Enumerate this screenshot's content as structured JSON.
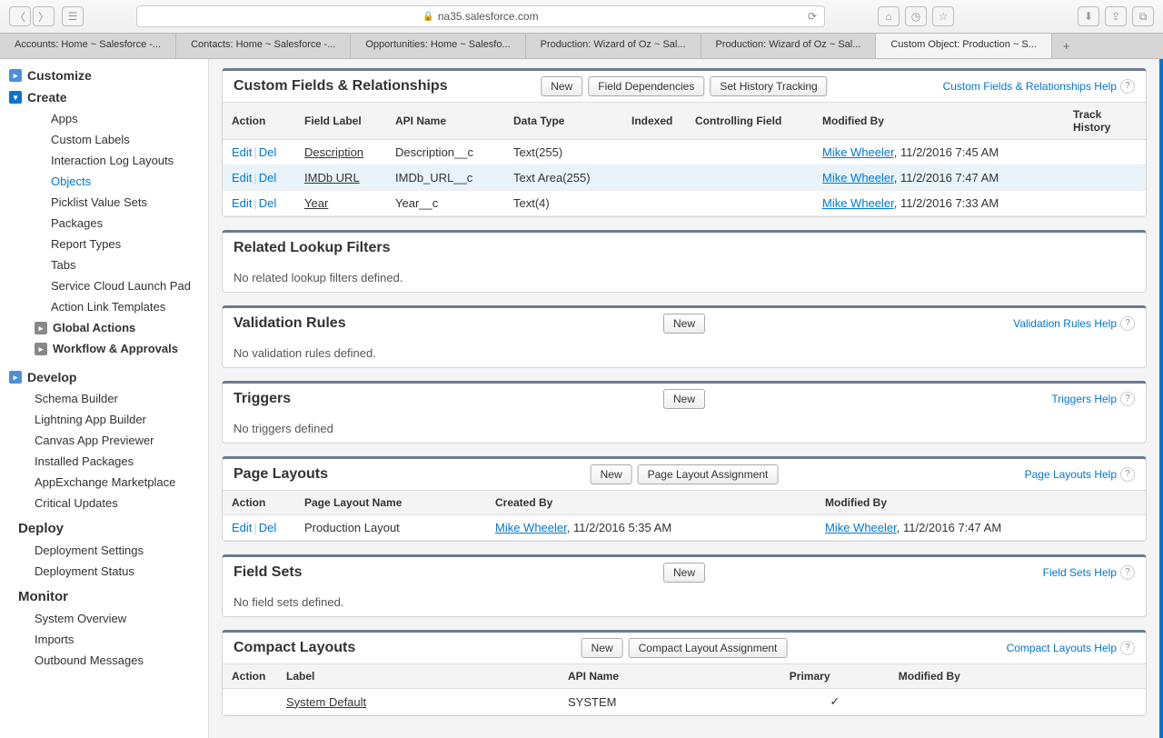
{
  "browser": {
    "url": "na35.salesforce.com",
    "tabs": [
      {
        "label": "Accounts: Home ~ Salesforce -..."
      },
      {
        "label": "Contacts: Home ~ Salesforce -..."
      },
      {
        "label": "Opportunities: Home ~ Salesfo..."
      },
      {
        "label": "Production: Wizard of Oz ~ Sal..."
      },
      {
        "label": "Production: Wizard of Oz ~ Sal..."
      },
      {
        "label": "Custom Object: Production ~ S..."
      }
    ],
    "activeTab": 5
  },
  "sidebar": {
    "customize": "Customize",
    "create": "Create",
    "createItems": [
      "Apps",
      "Custom Labels",
      "Interaction Log Layouts",
      "Objects",
      "Picklist Value Sets",
      "Packages",
      "Report Types",
      "Tabs",
      "Service Cloud Launch Pad",
      "Action Link Templates"
    ],
    "globalActions": "Global Actions",
    "workflow": "Workflow & Approvals",
    "develop": "Develop",
    "developItems": [
      "Schema Builder",
      "Lightning App Builder",
      "Canvas App Previewer",
      "Installed Packages",
      "AppExchange Marketplace",
      "Critical Updates"
    ],
    "deploy": "Deploy",
    "deployItems": [
      "Deployment Settings",
      "Deployment Status"
    ],
    "monitor": "Monitor",
    "monitorItems": [
      "System Overview",
      "Imports",
      "Outbound Messages"
    ]
  },
  "sections": {
    "customFields": {
      "title": "Custom Fields & Relationships",
      "buttons": [
        "New",
        "Field Dependencies",
        "Set History Tracking"
      ],
      "help": "Custom Fields & Relationships Help",
      "headers": [
        "Action",
        "Field Label",
        "API Name",
        "Data Type",
        "Indexed",
        "Controlling Field",
        "Modified By",
        "Track History"
      ],
      "rows": [
        {
          "label": "Description",
          "api": "Description__c",
          "type": "Text(255)",
          "by": "Mike Wheeler",
          "date": ", 11/2/2016 7:45 AM"
        },
        {
          "label": "IMDb URL",
          "api": "IMDb_URL__c",
          "type": "Text Area(255)",
          "by": "Mike Wheeler",
          "date": ", 11/2/2016 7:47 AM"
        },
        {
          "label": "Year",
          "api": "Year__c",
          "type": "Text(4)",
          "by": "Mike Wheeler",
          "date": ", 11/2/2016 7:33 AM"
        }
      ]
    },
    "relatedLookup": {
      "title": "Related Lookup Filters",
      "empty": "No related lookup filters defined."
    },
    "validation": {
      "title": "Validation Rules",
      "buttons": [
        "New"
      ],
      "help": "Validation Rules Help",
      "empty": "No validation rules defined."
    },
    "triggers": {
      "title": "Triggers",
      "buttons": [
        "New"
      ],
      "help": "Triggers Help",
      "empty": "No triggers defined"
    },
    "pageLayouts": {
      "title": "Page Layouts",
      "buttons": [
        "New",
        "Page Layout Assignment"
      ],
      "help": "Page Layouts Help",
      "headers": [
        "Action",
        "Page Layout Name",
        "Created By",
        "Modified By"
      ],
      "rows": [
        {
          "name": "Production Layout",
          "createdBy": "Mike Wheeler",
          "createdDate": ", 11/2/2016 5:35 AM",
          "modBy": "Mike Wheeler",
          "modDate": ", 11/2/2016 7:47 AM"
        }
      ]
    },
    "fieldSets": {
      "title": "Field Sets",
      "buttons": [
        "New"
      ],
      "help": "Field Sets Help",
      "empty": "No field sets defined."
    },
    "compactLayouts": {
      "title": "Compact Layouts",
      "buttons": [
        "New",
        "Compact Layout Assignment"
      ],
      "help": "Compact Layouts Help",
      "headers": [
        "Action",
        "Label",
        "API Name",
        "Primary",
        "Modified By"
      ],
      "rows": [
        {
          "label": "System Default",
          "api": "SYSTEM",
          "primary": "✓"
        }
      ]
    }
  },
  "actions": {
    "edit": "Edit",
    "del": "Del"
  }
}
